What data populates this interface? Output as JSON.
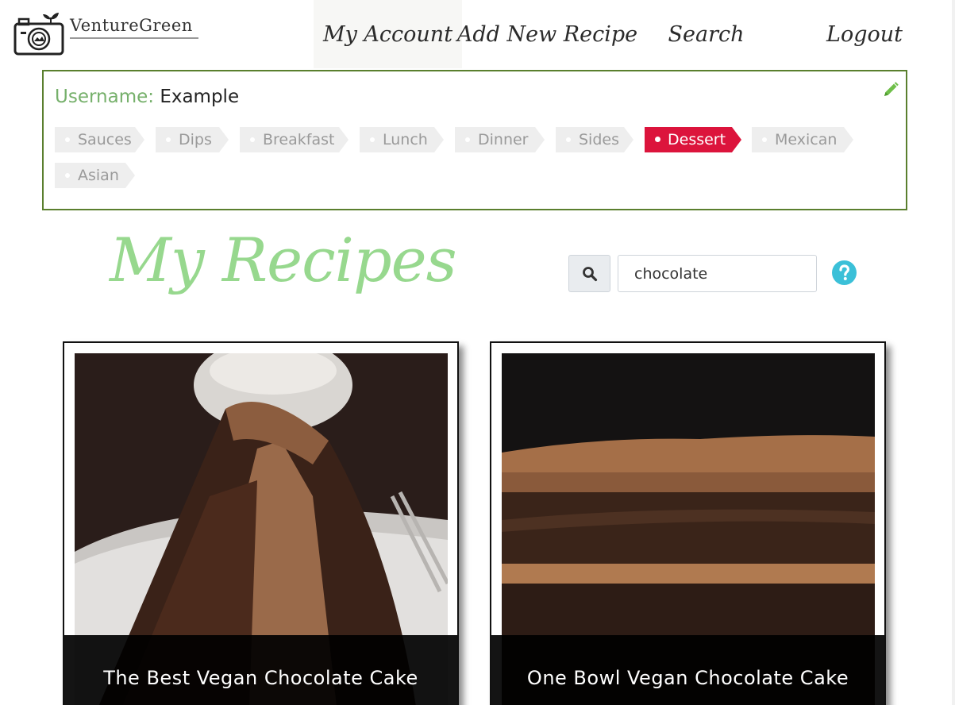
{
  "brand": {
    "name": "VentureGreen",
    "logo_icon": "camera-leaf-icon"
  },
  "nav": {
    "my_account": "My Account",
    "add_recipe": "Add New Recipe",
    "search": "Search",
    "logout": "Logout"
  },
  "profile": {
    "username_label": "Username:",
    "username_value": "Example",
    "edit_icon": "pencil-icon",
    "tags": [
      {
        "label": "Sauces",
        "active": false
      },
      {
        "label": "Dips",
        "active": false
      },
      {
        "label": "Breakfast",
        "active": false
      },
      {
        "label": "Lunch",
        "active": false
      },
      {
        "label": "Dinner",
        "active": false
      },
      {
        "label": "Sides",
        "active": false
      },
      {
        "label": "Dessert",
        "active": true
      },
      {
        "label": "Mexican",
        "active": false
      },
      {
        "label": "Asian",
        "active": false
      }
    ]
  },
  "main": {
    "title": "My Recipes",
    "search_value": "chocolate",
    "search_icon": "magnifier-icon",
    "help_icon": "question-circle-icon"
  },
  "recipes": [
    {
      "title": "The Best Vegan Chocolate Cake"
    },
    {
      "title": "One Bowl Vegan Chocolate Cake"
    }
  ],
  "colors": {
    "accent_green": "#97d88e",
    "border_green": "#5a7f2e",
    "active_tag": "#dc143c",
    "help_blue": "#3bc0d8"
  }
}
